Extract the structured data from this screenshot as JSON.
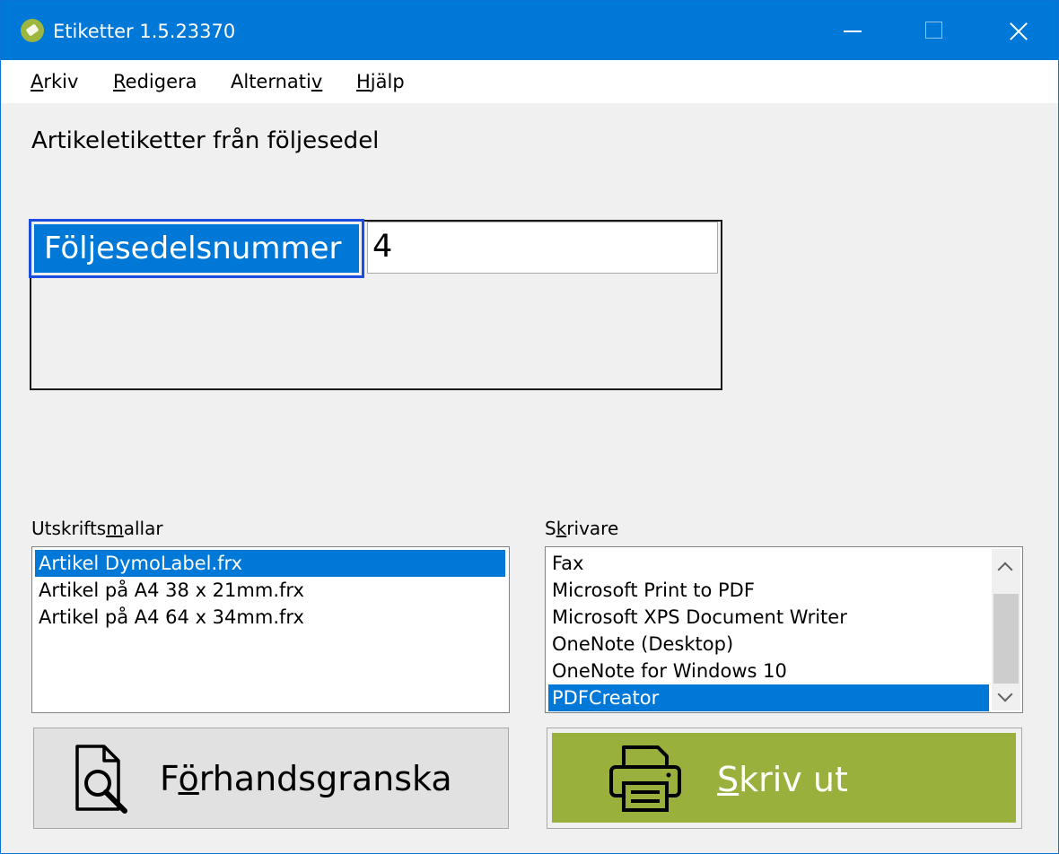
{
  "window": {
    "title": "Etiketter 1.5.23370"
  },
  "menu": {
    "arkiv": {
      "mn": "A",
      "rest": "rkiv"
    },
    "redigera": {
      "mn": "R",
      "rest": "edigera"
    },
    "alternativ": {
      "pre": "Alternati",
      "mn": "v"
    },
    "hjalp": {
      "mn": "H",
      "rest": "jälp"
    }
  },
  "heading": "Artikeletiketter från följesedel",
  "form": {
    "field_label": "Följesedelsnummer",
    "field_value": "4"
  },
  "templates": {
    "label_pre": "Utskrifts",
    "label_mn": "m",
    "label_post": "allar",
    "items": [
      "Artikel DymoLabel.frx",
      "Artikel på A4 38 x 21mm.frx",
      "Artikel på A4 64 x 34mm.frx"
    ],
    "selected_index": 0
  },
  "printers": {
    "label_pre": "S",
    "label_mn": "k",
    "label_post": "rivare",
    "items": [
      "Fax",
      "Microsoft Print to PDF",
      "Microsoft XPS Document Writer",
      "OneNote (Desktop)",
      "OneNote for Windows 10",
      "PDFCreator"
    ],
    "selected_index": 5
  },
  "buttons": {
    "preview": {
      "pre": "F",
      "mn": "ö",
      "post": "rhandsgranska",
      "icon": "document-search-icon"
    },
    "print": {
      "mn": "S",
      "post": "kriv ut",
      "icon": "printer-icon"
    }
  },
  "colors": {
    "titlebar": "#0078d7",
    "selection": "#0078d7",
    "print_button": "#99b13c",
    "focus_border": "#1b4ddf"
  }
}
